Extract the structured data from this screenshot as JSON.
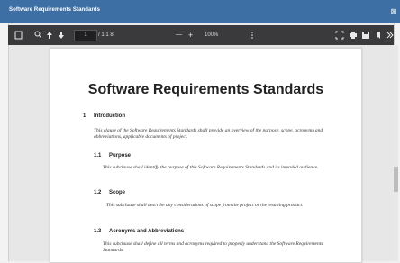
{
  "window": {
    "title": "Software Requirements Standards",
    "close_glyph": "⊠"
  },
  "toolbar": {
    "page_current": "1",
    "page_count": "/ 1 1 8",
    "zoom": "100%",
    "zoom_minus": "—",
    "zoom_plus": "+"
  },
  "document": {
    "title": "Software Requirements Standards",
    "sections": [
      {
        "num": "1",
        "heading": "Introduction",
        "text": "This clause of the Software Requirements Standards shall provide an overview of the purpose, scope, acronyms and abbreviations, applicable documents of project."
      },
      {
        "num": "1.1",
        "heading": "Purpose",
        "text": "This subclause shall identify the purpose of this Software Requirements Standards and its intended audience."
      },
      {
        "num": "1.2",
        "heading": "Scope",
        "text": "This subclause shall describe any considerations of scope from the project or the resulting product."
      },
      {
        "num": "1.3",
        "heading": "Acronyms and Abbreviations",
        "text": "This subclause shall define all terms and acronyms required to properly understand the Software Requirements Standards."
      }
    ]
  },
  "colors": {
    "titlebar": "#3d6fa5",
    "toolbar": "#3a3a3d"
  }
}
